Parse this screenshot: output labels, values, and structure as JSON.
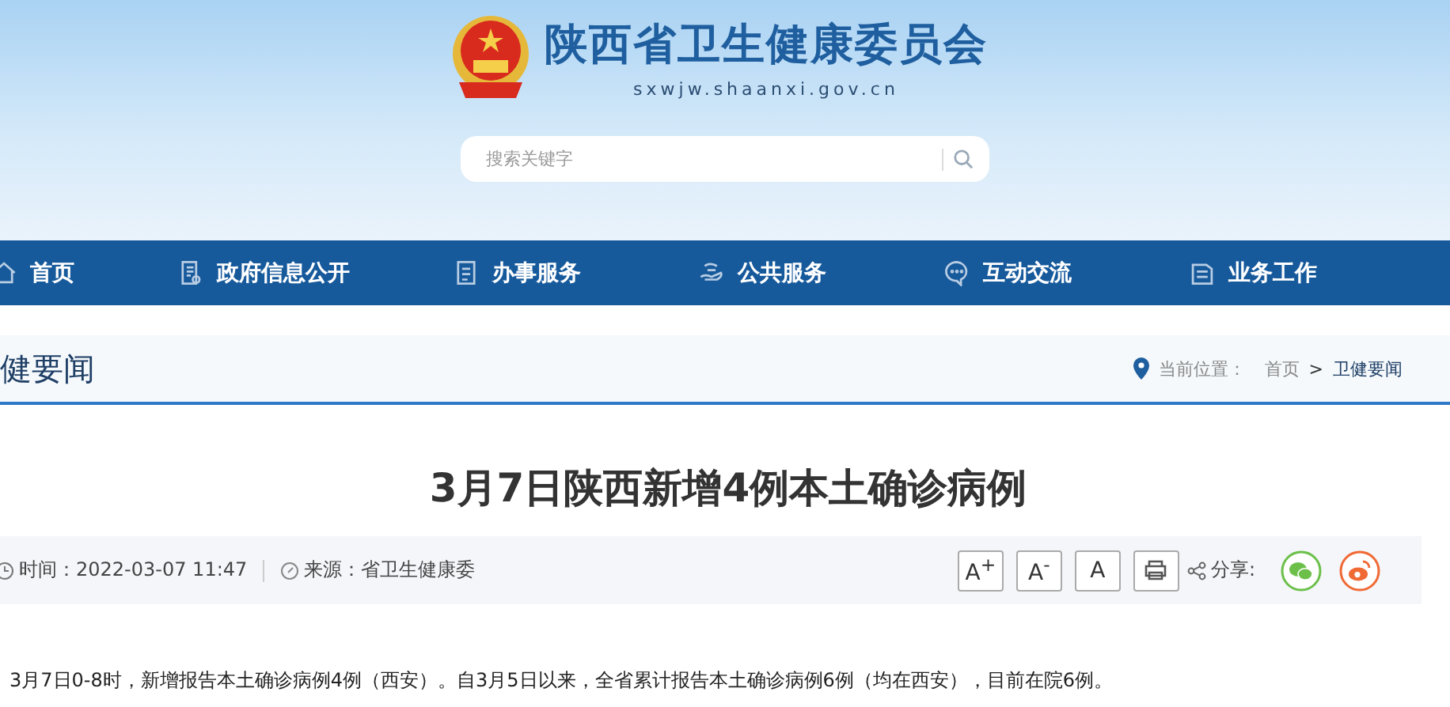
{
  "header": {
    "site_name": "陕西省卫生健康委员会",
    "domain": "sxwjw.shaanxi.gov.cn",
    "search": {
      "placeholder": "搜索关键字"
    }
  },
  "nav": [
    {
      "label": "首页",
      "kind": "home"
    },
    {
      "label": "政府信息公开",
      "kind": "doc"
    },
    {
      "label": "办事服务",
      "kind": "file"
    },
    {
      "label": "公共服务",
      "kind": "hand"
    },
    {
      "label": "互动交流",
      "kind": "chat"
    },
    {
      "label": "业务工作",
      "kind": "book"
    }
  ],
  "section": {
    "title": "健要闻",
    "breadcrumb_label": "当前位置：",
    "breadcrumb": [
      "首页",
      "卫健要闻"
    ],
    "separator": ">"
  },
  "article": {
    "title": "3月7日陕西新增4例本土确诊病例",
    "time": "时间：2022-03-07 11:47",
    "source": "来源：省卫生健康委",
    "font_buttons": [
      "A$^{+}$",
      "A$^{-}$",
      "A"
    ],
    "share_label": "分享:",
    "paragraph": "3月7日0-8时，新增报告本土确诊病例4例（西安）。自3月5日以来，全省累计报告本土确诊病例6例（均在西安），目前在院6例。"
  }
}
